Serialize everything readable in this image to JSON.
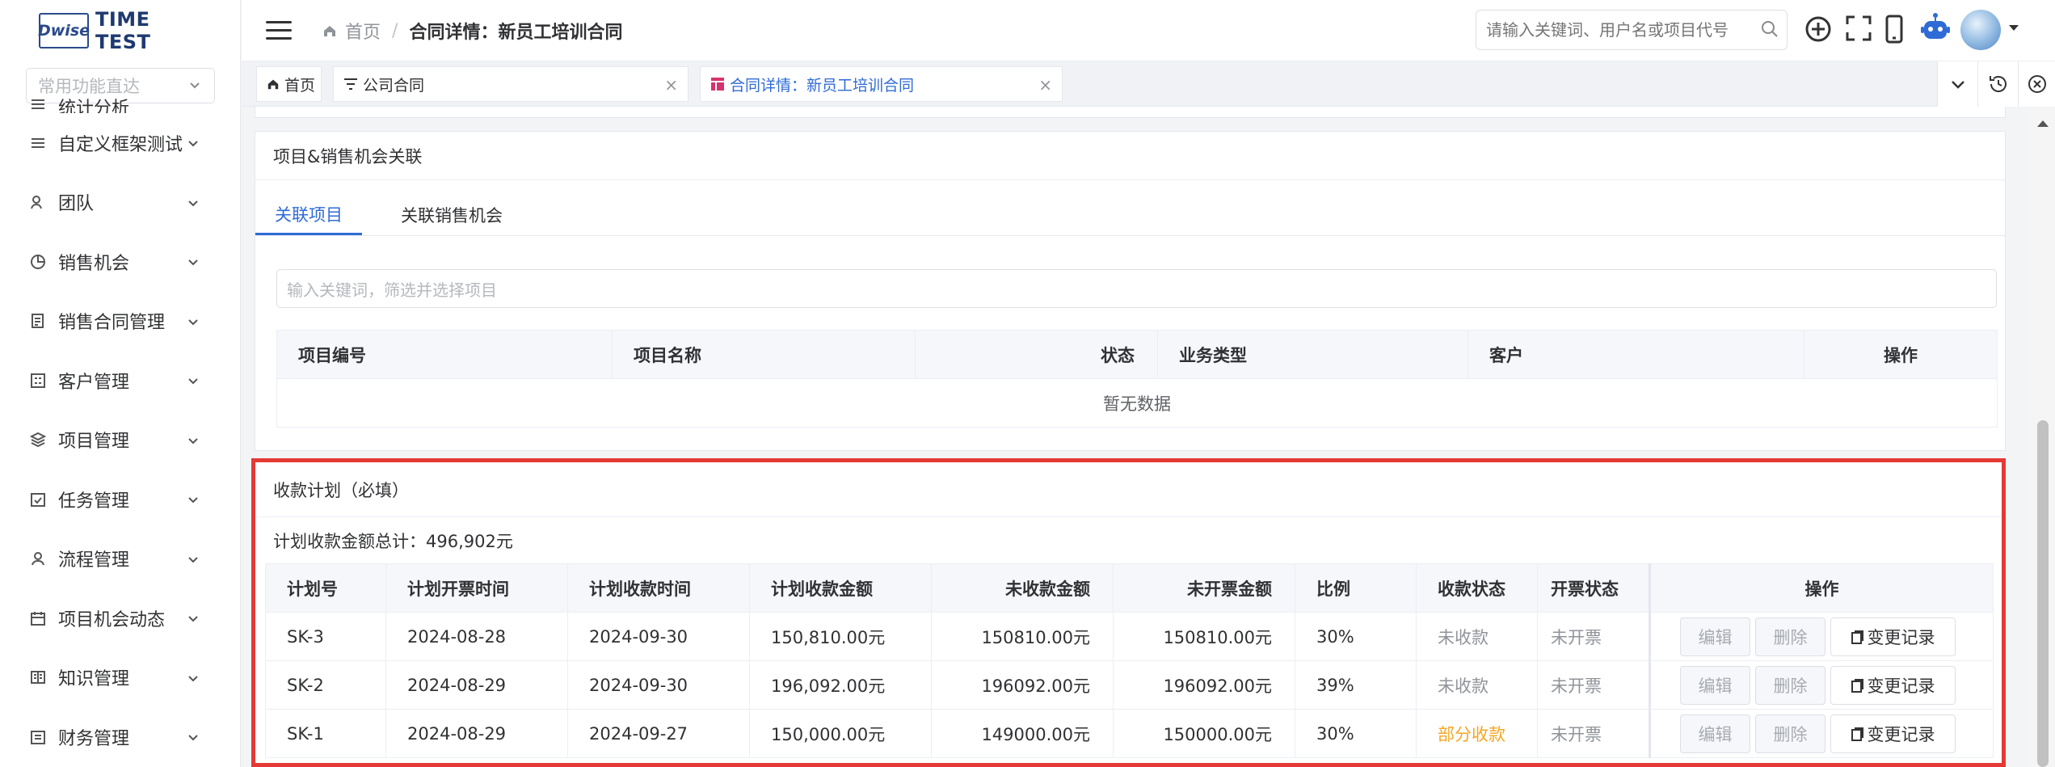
{
  "app": {
    "logo_mark": "Dwise",
    "logo_text": "TIME TEST"
  },
  "sidebar": {
    "quick_placeholder": "常用功能直达",
    "items": [
      {
        "label": "统计分析",
        "icon": "menu-lines-icon"
      },
      {
        "label": "自定义框架测试",
        "icon": "menu-lines-icon"
      },
      {
        "label": "团队",
        "icon": "team-icon"
      },
      {
        "label": "销售机会",
        "icon": "pie-icon"
      },
      {
        "label": "销售合同管理",
        "icon": "contract-icon"
      },
      {
        "label": "客户管理",
        "icon": "customer-icon"
      },
      {
        "label": "项目管理",
        "icon": "layers-icon"
      },
      {
        "label": "任务管理",
        "icon": "task-icon"
      },
      {
        "label": "流程管理",
        "icon": "user-icon"
      },
      {
        "label": "项目机会动态",
        "icon": "calendar-icon"
      },
      {
        "label": "知识管理",
        "icon": "book-icon"
      },
      {
        "label": "财务管理",
        "icon": "finance-icon"
      }
    ]
  },
  "header": {
    "breadcrumb_home": "首页",
    "breadcrumb_sep": "/",
    "breadcrumb_current": "合同详情：新员工培训合同",
    "search_placeholder": "请输入关键词、用户名或项目代号"
  },
  "tabs": [
    {
      "label": "首页"
    },
    {
      "label": "公司合同"
    },
    {
      "label": "合同详情：新员工培训合同"
    }
  ],
  "project_panel": {
    "title": "项目&销售机会关联",
    "subtabs": [
      "关联项目",
      "关联销售机会"
    ],
    "filter_placeholder": "输入关键词，筛选并选择项目",
    "columns": [
      "项目编号",
      "项目名称",
      "状态",
      "业务类型",
      "客户",
      "操作"
    ],
    "empty_text": "暂无数据"
  },
  "payment_plan": {
    "title": "收款计划（必填）",
    "total_label": "计划收款金额总计：496,902元",
    "columns": [
      "计划号",
      "计划开票时间",
      "计划收款时间",
      "计划收款金额",
      "未收款金额",
      "未开票金额",
      "比例",
      "收款状态",
      "开票状态",
      "操作"
    ],
    "rows": [
      {
        "id": "SK-3",
        "invoice_date": "2024-08-28",
        "collect_date": "2024-09-30",
        "amount": "150,810.00元",
        "uncollected": "150810.00元",
        "uninvoiced": "150810.00元",
        "ratio": "30%",
        "collect_status": "未收款",
        "invoice_status": "未开票"
      },
      {
        "id": "SK-2",
        "invoice_date": "2024-08-29",
        "collect_date": "2024-09-30",
        "amount": "196,092.00元",
        "uncollected": "196092.00元",
        "uninvoiced": "196092.00元",
        "ratio": "39%",
        "collect_status": "未收款",
        "invoice_status": "未开票"
      },
      {
        "id": "SK-1",
        "invoice_date": "2024-08-29",
        "collect_date": "2024-09-27",
        "amount": "150,000.00元",
        "uncollected": "149000.00元",
        "uninvoiced": "150000.00元",
        "ratio": "30%",
        "collect_status": "部分收款",
        "invoice_status": "未开票"
      }
    ],
    "actions": {
      "edit": "编辑",
      "delete": "删除",
      "log": "变更记录"
    }
  },
  "colors": {
    "accent": "#2f6bd6",
    "highlight_border": "#e53935",
    "warning": "#f5a623"
  }
}
